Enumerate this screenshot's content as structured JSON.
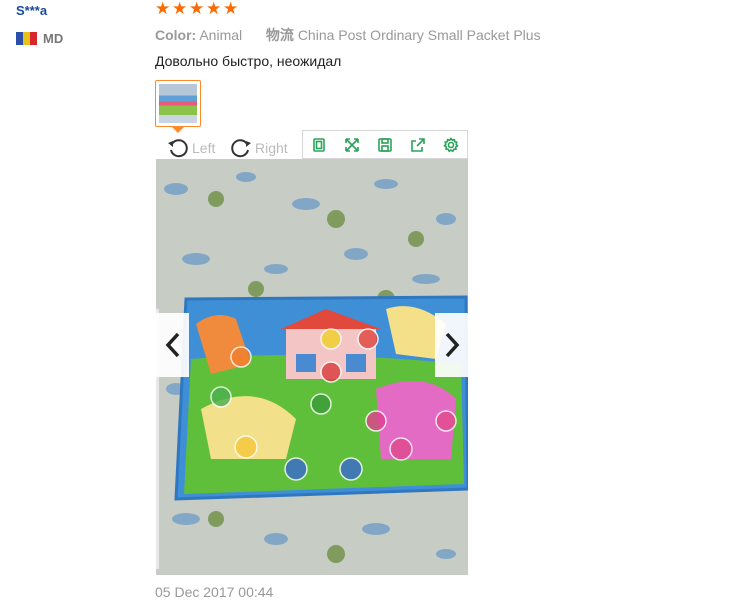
{
  "user": {
    "name": "S***a",
    "country": "MD",
    "flag_colors": [
      "#2b4ea8",
      "#e8c21a",
      "#d9262c"
    ]
  },
  "review": {
    "stars": [
      "★",
      "★",
      "★",
      "★",
      "★"
    ],
    "rating": 5,
    "star_color": "#ff6a00",
    "color_label": "Color:",
    "color_value": "Animal",
    "shipping_label": "物流",
    "shipping_value": "China Post Ordinary Small Packet Plus",
    "feedback": "Довольно быстро, неожидал",
    "date": "05 Dec 2017 00:44"
  },
  "viewer": {
    "rotate_left_label": "Left",
    "rotate_right_label": "Right",
    "tools": [
      "original-size-icon",
      "fullscreen-icon",
      "save-icon",
      "share-icon",
      "settings-icon"
    ],
    "accent_color": "#2aa35a",
    "thumb_border_color": "#ff8a2a"
  }
}
